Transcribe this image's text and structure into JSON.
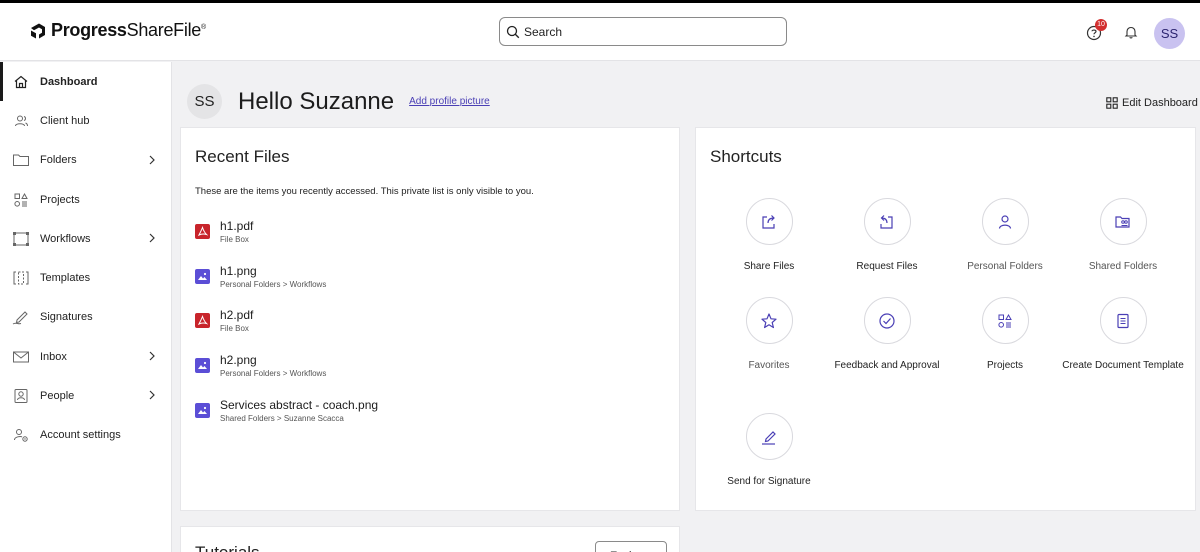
{
  "app": {
    "logo_bold": "Progress",
    "logo_light": "ShareFile",
    "logo_mark": "®"
  },
  "header": {
    "search_placeholder": "Search",
    "help_badge": "10",
    "user_initials": "SS"
  },
  "sidebar": {
    "items": [
      {
        "label": "Dashboard",
        "icon": "home-icon",
        "active": true
      },
      {
        "label": "Client hub",
        "icon": "users-icon"
      },
      {
        "label": "Folders",
        "icon": "folder-icon",
        "chevron": true
      },
      {
        "label": "Projects",
        "icon": "projects-icon"
      },
      {
        "label": "Workflows",
        "icon": "workflows-icon",
        "chevron": true
      },
      {
        "label": "Templates",
        "icon": "templates-icon"
      },
      {
        "label": "Signatures",
        "icon": "signature-icon"
      },
      {
        "label": "Inbox",
        "icon": "inbox-icon",
        "chevron": true
      },
      {
        "label": "People",
        "icon": "people-icon",
        "chevron": true
      },
      {
        "label": "Account settings",
        "icon": "account-settings-icon"
      }
    ]
  },
  "greeting": {
    "initials": "SS",
    "hello": "Hello Suzanne",
    "add_picture": "Add profile picture",
    "edit_dashboard": "Edit Dashboard"
  },
  "recent_files": {
    "title": "Recent Files",
    "description": "These are the items you recently accessed. This private list is only visible to you.",
    "files": [
      {
        "name": "h1.pdf",
        "path": "File Box",
        "type": "pdf"
      },
      {
        "name": "h1.png",
        "path": "Personal Folders > Workflows",
        "type": "png"
      },
      {
        "name": "h2.pdf",
        "path": "File Box",
        "type": "pdf"
      },
      {
        "name": "h2.png",
        "path": "Personal Folders > Workflows",
        "type": "png"
      },
      {
        "name": "Services abstract - coach.png",
        "path": "Shared Folders > Suzanne Scacca",
        "type": "png"
      }
    ]
  },
  "shortcuts": {
    "title": "Shortcuts",
    "items": [
      {
        "label": "Share Files",
        "icon": "share-files-icon"
      },
      {
        "label": "Request Files",
        "icon": "request-files-icon"
      },
      {
        "label": "Personal Folders",
        "icon": "personal-folders-icon"
      },
      {
        "label": "Shared Folders",
        "icon": "shared-folders-icon"
      },
      {
        "label": "Favorites",
        "icon": "star-icon"
      },
      {
        "label": "Feedback and Approval",
        "icon": "check-circle-icon"
      },
      {
        "label": "Projects",
        "icon": "projects-icon"
      },
      {
        "label": "Create Document Template",
        "icon": "document-template-icon"
      },
      {
        "label": "Send for Signature",
        "icon": "pen-icon"
      }
    ]
  },
  "tutorials": {
    "title": "Tutorials",
    "button": "Explore"
  },
  "colors": {
    "accent": "#4a3fb5",
    "pdf": "#c8242b",
    "image": "#5b4ed6",
    "avatar_bg": "#c9c2f0"
  }
}
